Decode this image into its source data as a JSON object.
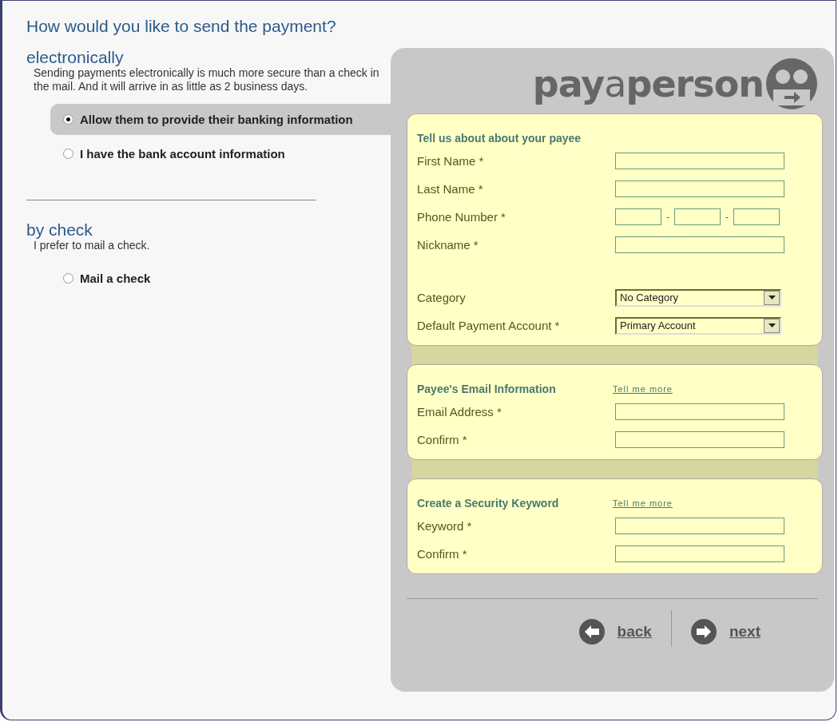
{
  "heading": "How would you like to send the payment?",
  "methods": [
    {
      "title": "electronically",
      "description": "Sending payments electronically is much more secure than a check in the mail. And it will arrive in as little as 2 business days.",
      "options": [
        {
          "label": "Allow them to provide their banking information",
          "selected": true
        },
        {
          "label": "I have the bank account information",
          "selected": false
        }
      ]
    },
    {
      "title": "by check",
      "description": "I prefer to mail a check.",
      "options": [
        {
          "label": "Mail a check",
          "selected": false
        }
      ]
    }
  ],
  "logo": {
    "lead": "pay",
    "middle": "a",
    "tail": "person"
  },
  "sections": [
    {
      "title": "Tell us about about your payee",
      "fields": [
        {
          "kind": "text",
          "label": "First Name *"
        },
        {
          "kind": "text",
          "label": "Last Name *"
        },
        {
          "kind": "phone",
          "label": "Phone Number *",
          "separator": "-"
        },
        {
          "kind": "text",
          "label": "Nickname *"
        },
        {
          "kind": "select",
          "label": "Category",
          "value": "No Category"
        },
        {
          "kind": "select",
          "label": "Default Payment Account *",
          "value": "Primary Account"
        }
      ]
    },
    {
      "title": "Payee's Email Information",
      "link": "Tell me more",
      "fields": [
        {
          "kind": "text",
          "label": "Email Address *"
        },
        {
          "kind": "text",
          "label": "Confirm *"
        }
      ]
    },
    {
      "title": "Create a Security Keyword",
      "link": "Tell me more",
      "fields": [
        {
          "kind": "text",
          "label": "Keyword *"
        },
        {
          "kind": "text",
          "label": "Confirm *"
        }
      ]
    }
  ],
  "nav": [
    {
      "kind": "back",
      "label": "back"
    },
    {
      "kind": "next",
      "label": "next"
    }
  ]
}
